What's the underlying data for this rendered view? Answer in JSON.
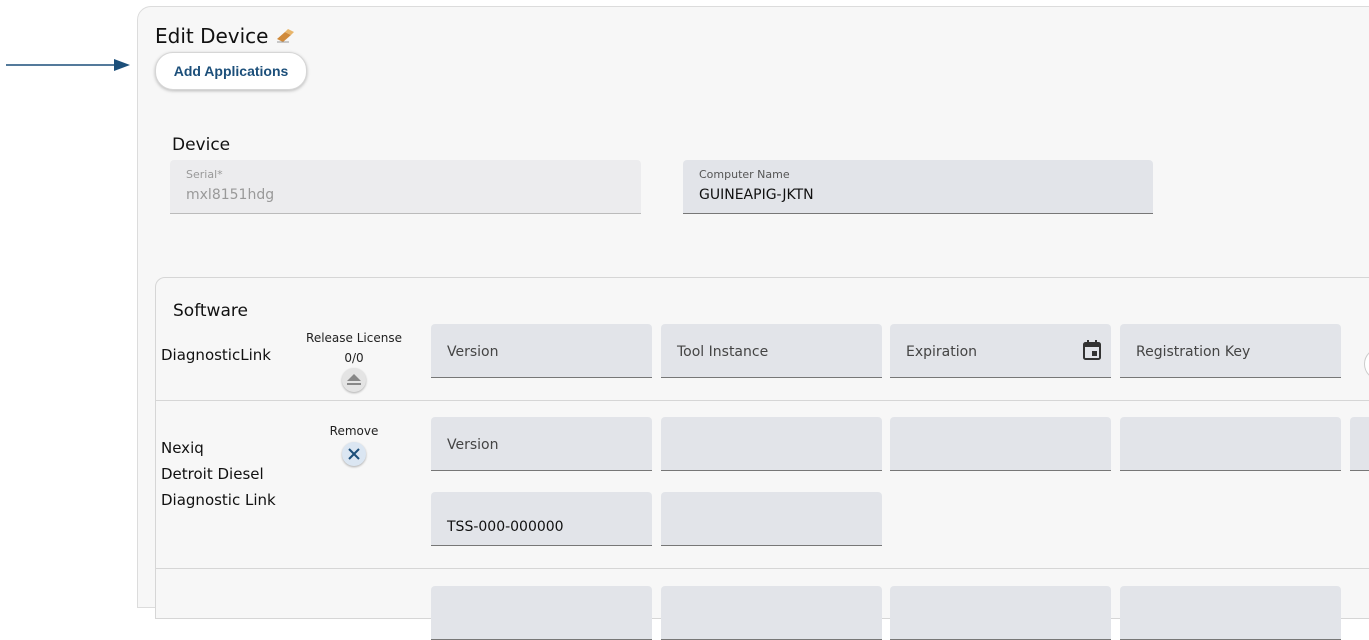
{
  "header": {
    "title": "Edit Device",
    "add_applications_label": "Add Applications"
  },
  "icons": {
    "arrow": "arrow-right-icon",
    "title_icon": "eraser-icon"
  },
  "device": {
    "section_title": "Device",
    "serial": {
      "label": "Serial*",
      "value": "mxl8151hdg"
    },
    "computer_name": {
      "label": "Computer Name",
      "value": "GUINEAPIG-JKTN"
    }
  },
  "software": {
    "section_title": "Software",
    "rows": [
      {
        "name": "DiagnosticLink",
        "action_label": "Release License",
        "license_count": "0/0",
        "fields": [
          "Version",
          "Tool Instance",
          "Expiration",
          "Registration Key"
        ]
      },
      {
        "name_lines": [
          "Nexiq",
          "Detroit Diesel",
          "Diagnostic Link"
        ],
        "action_label": "Remove",
        "fields": [
          "Version",
          "",
          "",
          ""
        ],
        "second_line_value": "TSS-000-000000"
      }
    ]
  },
  "colors": {
    "accent": "#1c4f7a",
    "field_bg": "#e2e4e9",
    "panel_bg": "#f7f7f7"
  }
}
